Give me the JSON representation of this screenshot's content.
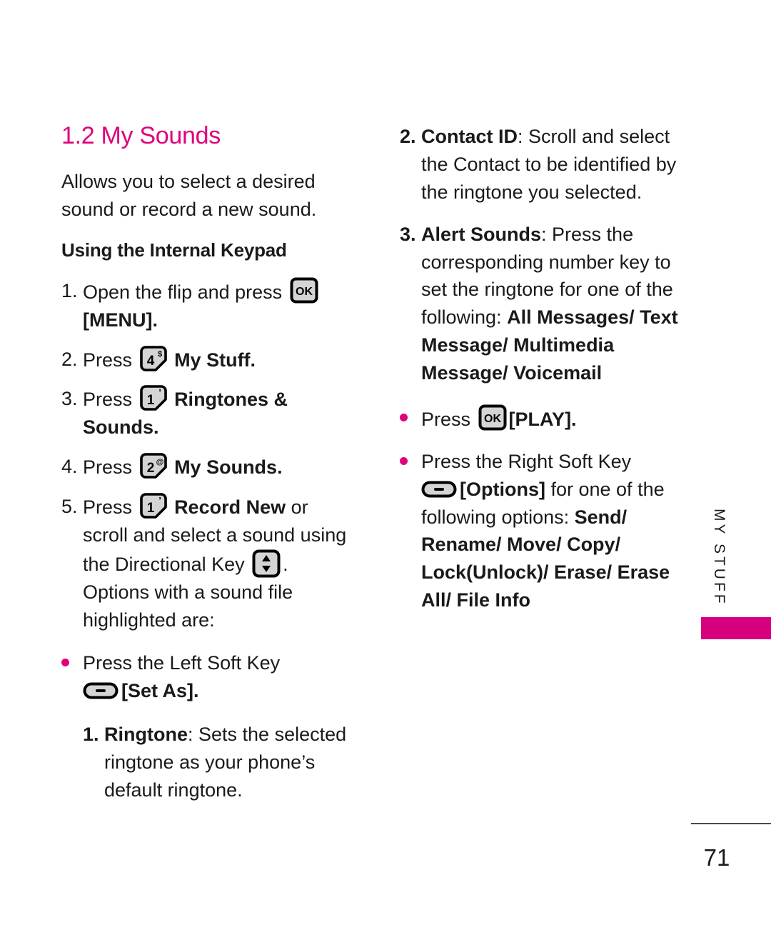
{
  "page": {
    "number": "71",
    "side_tab": "MY STUFF",
    "accent_color": "#e0007c",
    "tab_color": "#d6007f"
  },
  "left_column": {
    "title": "1.2 My Sounds",
    "intro": "Allows you to select a desired sound or record a new sound.",
    "subhead": "Using the Internal Keypad",
    "steps": [
      {
        "num": "1.",
        "pre": "Open the flip and press",
        "icon": "ok-key",
        "post": "",
        "bold_tail": "[MENU]."
      },
      {
        "num": "2.",
        "pre": "Press",
        "icon": "num-key-4",
        "key_digit": "4",
        "key_sup": "$",
        "bold_tail": "My Stuff."
      },
      {
        "num": "3.",
        "pre": "Press",
        "icon": "num-key-1",
        "key_digit": "1",
        "key_sup": "'",
        "bold_tail": "Ringtones & Sounds."
      },
      {
        "num": "4.",
        "pre": "Press",
        "icon": "num-key-2",
        "key_digit": "2",
        "key_sup": "@",
        "bold_tail": "My Sounds."
      },
      {
        "num": "5.",
        "pre": "Press",
        "icon": "num-key-1",
        "key_digit": "1",
        "key_sup": "'",
        "bold_tail": "Record New",
        "tail_after": " or scroll and select a sound using the Directional Key",
        "icon2": "directional-key",
        "tail_end": ". Options with a sound file highlighted are:"
      }
    ],
    "bullet": {
      "text_before": "Press the Left Soft Key",
      "icon": "soft-key",
      "bracket_label": "[Set As]."
    },
    "substep": {
      "num": "1.",
      "label": "Ringtone",
      "colon": ":",
      "text": " Sets the selected ringtone as your phone’s default ringtone."
    }
  },
  "right_column": {
    "steps": [
      {
        "num": "2.",
        "label": "Contact ID",
        "colon": ":",
        "text": " Scroll and select the Contact to be identified by the ringtone you selected."
      },
      {
        "num": "3.",
        "label": "Alert Sounds",
        "colon": ":",
        "text": " Press the corresponding number key to set the ringtone for one of the following: ",
        "options_bold": "All Messages/ Text Message/ Multimedia Message/ Voicemail"
      }
    ],
    "bullets": [
      {
        "text_before": "Press",
        "icon": "ok-key",
        "bracket_label": "[PLAY]."
      },
      {
        "text_before": "Press the Right Soft Key",
        "icon": "soft-key",
        "bracket_label": "[Options]",
        "text_after": " for one of the following options:",
        "options_bold": "Send/ Rename/ Move/ Copy/ Lock(Unlock)/ Erase/ Erase All/ File Info"
      }
    ]
  }
}
